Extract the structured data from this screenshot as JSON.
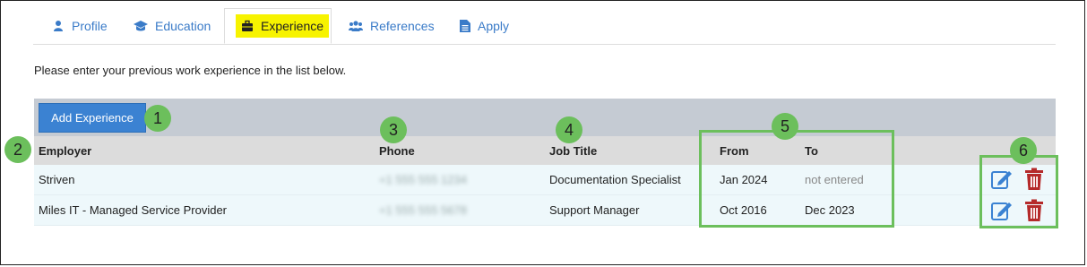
{
  "tabs": [
    {
      "label": "Profile",
      "icon": "user-icon"
    },
    {
      "label": "Education",
      "icon": "graduation-cap-icon"
    },
    {
      "label": "Experience",
      "icon": "briefcase-icon"
    },
    {
      "label": "References",
      "icon": "users-icon"
    },
    {
      "label": "Apply",
      "icon": "document-icon"
    }
  ],
  "active_tab": "Experience",
  "intro_text": "Please enter your previous work experience in the list below.",
  "toolbar": {
    "add_label": "Add Experience"
  },
  "columns": {
    "employer": "Employer",
    "phone": "Phone",
    "job_title": "Job Title",
    "from": "From",
    "to": "To"
  },
  "rows": [
    {
      "employer": "Striven",
      "phone": "+1 555 555 1234",
      "job_title": "Documentation Specialist",
      "from": "Jan 2024",
      "to": "not entered"
    },
    {
      "employer": "Miles IT - Managed Service Provider",
      "phone": "+1 555 555 5678",
      "job_title": "Support Manager",
      "from": "Oct 2016",
      "to": "Dec 2023"
    }
  ],
  "callouts": [
    "1",
    "2",
    "3",
    "4",
    "5",
    "6"
  ],
  "colors": {
    "accent": "#3b82d2",
    "highlight": "#f7f300",
    "callout": "#6cbf5c",
    "delete": "#b52a2a"
  }
}
